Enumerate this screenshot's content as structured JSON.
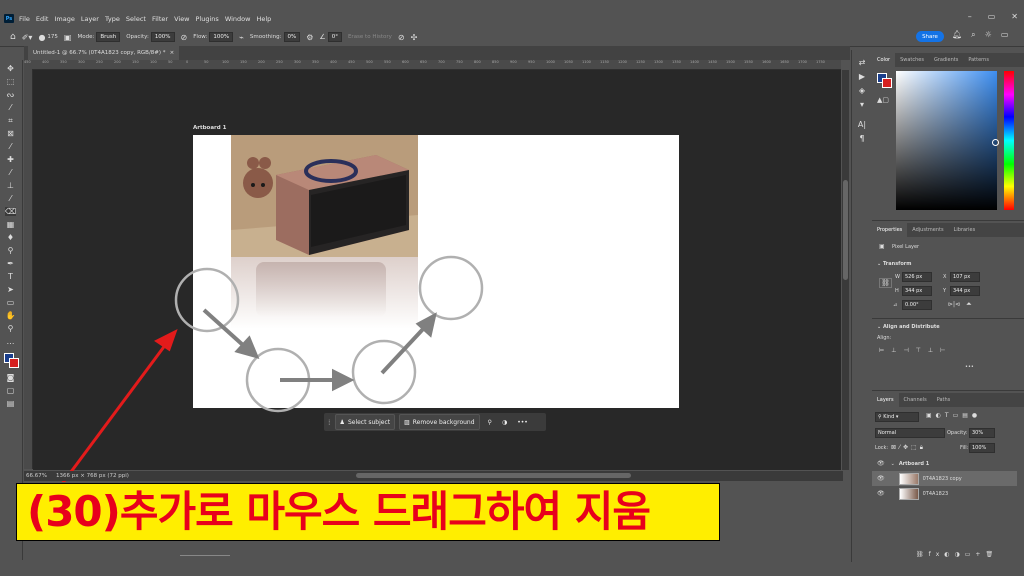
{
  "app": {
    "logo": "Ps",
    "menu": [
      "File",
      "Edit",
      "Image",
      "Layer",
      "Type",
      "Select",
      "Filter",
      "View",
      "Plugins",
      "Window",
      "Help"
    ],
    "window_controls": [
      "–",
      "▭",
      "✕"
    ]
  },
  "options": {
    "brush_size": "175",
    "mode_label": "Mode:",
    "mode_value": "Brush",
    "opacity_label": "Opacity:",
    "opacity_value": "100%",
    "flow_label": "Flow:",
    "flow_value": "100%",
    "smoothing_label": "Smoothing:",
    "smoothing_value": "0%",
    "angle_value": "0°",
    "erase_history": "Erase to History",
    "share_label": "Share"
  },
  "document": {
    "tab_title": "Untitled-1 @ 66.7% (0T4A1823 copy, RGB/8#) *",
    "tab_close": "×",
    "ruler_ticks": [
      "450",
      "400",
      "350",
      "300",
      "250",
      "200",
      "150",
      "100",
      "50",
      "0",
      "50",
      "100",
      "150",
      "200",
      "250",
      "300",
      "350",
      "400",
      "450",
      "500",
      "550",
      "600",
      "650",
      "700",
      "750",
      "800",
      "850",
      "900",
      "950",
      "1000",
      "1050",
      "1100",
      "1150",
      "1200",
      "1250",
      "1300",
      "1350",
      "1400",
      "1450",
      "1500",
      "1550",
      "1600",
      "1650",
      "1700",
      "1750"
    ],
    "artboard_label": "Artboard 1",
    "zoom": "66.67%",
    "doc_info": "1366 px × 768 px (72 ppi)"
  },
  "contextual_taskbar": {
    "select_subject": "Select subject",
    "remove_background": "Remove background"
  },
  "color_panel": {
    "tabs": [
      "Color",
      "Swatches",
      "Gradients",
      "Patterns"
    ],
    "foreground": "#1a3e8c",
    "background": "#d62020"
  },
  "properties_panel": {
    "tabs": [
      "Properties",
      "Adjustments",
      "Libraries"
    ],
    "layer_type": "Pixel Layer",
    "transform_label": "Transform",
    "w_label": "W",
    "w_value": "526 px",
    "h_label": "H",
    "h_value": "344 px",
    "x_label": "X",
    "x_value": "107 px",
    "y_label": "Y",
    "y_value": "344 px",
    "angle": "0.00°",
    "align_label": "Align and Distribute",
    "align_sub": "Align:",
    "more": "•••"
  },
  "layers_panel": {
    "tabs": [
      "Layers",
      "Channels",
      "Paths"
    ],
    "kind": "Kind",
    "blend": "Normal",
    "opacity_label": "Opacity:",
    "opacity_value": "30%",
    "lock_label": "Lock:",
    "fill_label": "Fill:",
    "fill_value": "100%",
    "layers": [
      {
        "name": "Artboard 1"
      },
      {
        "name": "0T4A1823 copy"
      },
      {
        "name": "0T4A1823"
      }
    ]
  },
  "caption": "(30)추가로 마우스 드래그하여 지움"
}
